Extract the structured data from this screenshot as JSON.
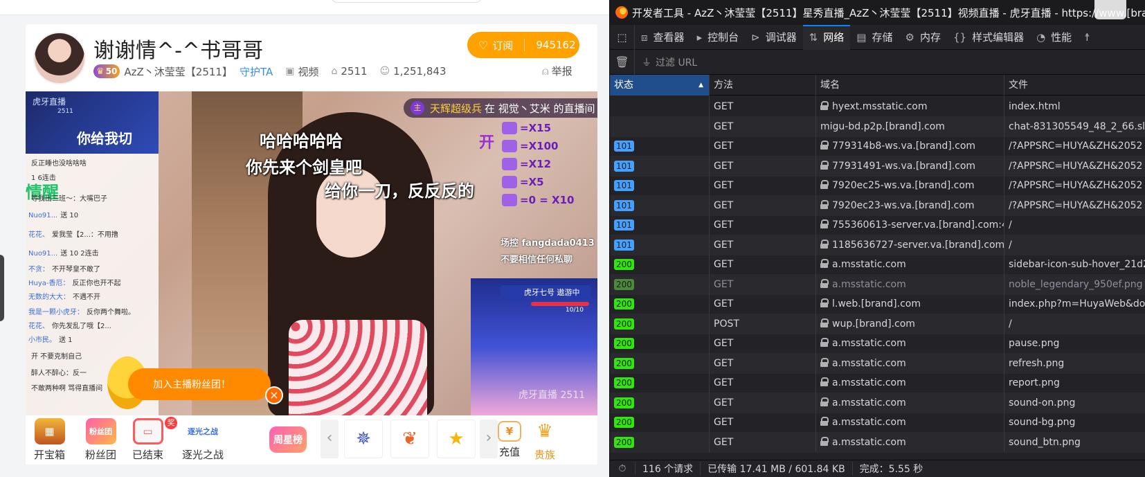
{
  "stream": {
    "title": "谢谢情^-^书哥哥",
    "level": "50",
    "anchor_name": "AzZ丶沐莹莹【2511】",
    "guard_link": "守护TA",
    "video_label": "视频",
    "room_id": "2511",
    "viewers": "1,251,843",
    "subscribe_label": "订阅",
    "subscribe_count": "945162",
    "report_label": "举报",
    "overlay": {
      "chat_banner_title": "虎牙直播",
      "chat_banner_id": "2511",
      "chat_banner_text": "你给我切",
      "wake_text": "情醒",
      "chat_lines": [
        {
          "user": "",
          "text": "反正睡也没啥啥啥"
        },
        {
          "user": "",
          "text": "1 6连击"
        },
        {
          "user": "",
          "text": "等我出三班～：大嘴巴子"
        },
        {
          "user": "Nuo91...",
          "text": "送 10"
        },
        {
          "user": "花花、",
          "text": "爱我莹【2...：不用撸"
        },
        {
          "user": "Nuo91...",
          "text": "送 10 2连击"
        },
        {
          "user": "不贪：",
          "text": "不开琴皇不敢了"
        },
        {
          "user": "Huya-香厄：",
          "text": "反正你也开不起"
        },
        {
          "user": "无数的大大：",
          "text": "不遇不开"
        },
        {
          "user": "我是一颗小虎牙：",
          "text": "反你两个舞啦。"
        },
        {
          "user": "花花、",
          "text": "你先发乱了哦【2..."
        },
        {
          "user": "小市民。",
          "text": "送 1"
        },
        {
          "user": "",
          "text": "开 不要克制自己"
        },
        {
          "user": "",
          "text": "醉人不醉心：反一"
        },
        {
          "user": "",
          "text": "不敢两种啊 骂得直播间"
        }
      ],
      "caption_1": "哈哈哈哈哈",
      "caption_2": "你先来个剑皇吧",
      "caption_3": "给你一刀，反反反的",
      "ticker_tag": "主",
      "ticker_highlight": "天辉超级兵",
      "ticker_text": "在 视觉丶艾米 的直播间",
      "kai": "开",
      "gift_rows": [
        "=X15",
        "=X100",
        "=X12",
        "=X5",
        "=0 = X10"
      ],
      "contact": "场控 fangdada0413",
      "warning": "不要相信任何私聊",
      "game_title": "虎牙七号 遨游中",
      "game_count": "10/10",
      "watermark": "虎牙直播 2511",
      "fan_bubble": "加入主播粉丝团！"
    },
    "toolbar": {
      "treasure": "开宝箱",
      "fan_club": "粉丝团",
      "fan_club_icon_text": "粉丝团",
      "ended": "已结束",
      "ended_badge": "奖",
      "chase_light": "逐光之战",
      "chase_light_icon_text": "逐光之战",
      "weekstar": "周星榜",
      "recharge": "充值",
      "noble": "贵族"
    }
  },
  "devtools": {
    "window_title": "开发者工具 - AzZ丶沐莹莹【2511】星秀直播_AzZ丶沐莹莹【2511】视频直播 - 虎牙直播 - https://www.[brand].",
    "tabs": [
      {
        "label": "查看器",
        "icon": "inspector-icon"
      },
      {
        "label": "控制台",
        "icon": "console-icon"
      },
      {
        "label": "调试器",
        "icon": "debugger-icon"
      },
      {
        "label": "网络",
        "icon": "network-icon"
      },
      {
        "label": "存储",
        "icon": "storage-icon"
      },
      {
        "label": "内存",
        "icon": "memory-icon"
      },
      {
        "label": "样式编辑器",
        "icon": "style-editor-icon"
      },
      {
        "label": "性能",
        "icon": "performance-icon"
      }
    ],
    "active_tab": "网络",
    "filter_placeholder": "过滤 URL",
    "columns": {
      "status": "状态",
      "method": "方法",
      "domain": "域名",
      "file": "文件"
    },
    "requests": [
      {
        "status": "",
        "method": "GET",
        "domain": "hyext.msstatic.com",
        "file": "index.html",
        "secure": true,
        "cached": false
      },
      {
        "status": "",
        "method": "GET",
        "domain": "migu-bd.p2p.[brand].com",
        "file": "chat-831305549_48_2_66.slice",
        "secure": false,
        "cached": false
      },
      {
        "status": "101",
        "method": "GET",
        "domain": "779314b8-ws.va.[brand].com",
        "file": "/?APPSRC=HUYA&ZH&2052",
        "secure": true,
        "cached": false
      },
      {
        "status": "101",
        "method": "GET",
        "domain": "77931491-ws.va.[brand].com",
        "file": "/?APPSRC=HUYA&ZH&2052",
        "secure": true,
        "cached": false
      },
      {
        "status": "101",
        "method": "GET",
        "domain": "7920ec25-ws.va.[brand].com",
        "file": "/?APPSRC=HUYA&ZH&2052",
        "secure": true,
        "cached": false
      },
      {
        "status": "101",
        "method": "GET",
        "domain": "7920ec23-ws.va.[brand].com",
        "file": "/?APPSRC=HUYA&ZH&2052",
        "secure": true,
        "cached": false
      },
      {
        "status": "101",
        "method": "GET",
        "domain": "755360613-server.va.[brand].com:4457",
        "file": "/",
        "secure": true,
        "cached": false
      },
      {
        "status": "101",
        "method": "GET",
        "domain": "1185636727-server.va.[brand].com:44...",
        "file": "/",
        "secure": true,
        "cached": false
      },
      {
        "status": "200",
        "method": "GET",
        "domain": "a.msstatic.com",
        "file": "sidebar-icon-sub-hover_21d2",
        "secure": true,
        "cached": false
      },
      {
        "status": "200",
        "method": "GET",
        "domain": "a.msstatic.com",
        "file": "noble_legendary_950ef.png",
        "secure": true,
        "cached": true
      },
      {
        "status": "200",
        "method": "GET",
        "domain": "l.web.[brand].com",
        "file": "index.php?m=HuyaWeb&do=",
        "secure": true,
        "cached": false
      },
      {
        "status": "200",
        "method": "POST",
        "domain": "wup.[brand].com",
        "file": "/",
        "secure": true,
        "cached": false
      },
      {
        "status": "200",
        "method": "GET",
        "domain": "a.msstatic.com",
        "file": "pause.png",
        "secure": true,
        "cached": false
      },
      {
        "status": "200",
        "method": "GET",
        "domain": "a.msstatic.com",
        "file": "refresh.png",
        "secure": true,
        "cached": false
      },
      {
        "status": "200",
        "method": "GET",
        "domain": "a.msstatic.com",
        "file": "report.png",
        "secure": true,
        "cached": false
      },
      {
        "status": "200",
        "method": "GET",
        "domain": "a.msstatic.com",
        "file": "sound-on.png",
        "secure": true,
        "cached": false
      },
      {
        "status": "200",
        "method": "GET",
        "domain": "a.msstatic.com",
        "file": "sound-bg.png",
        "secure": true,
        "cached": false
      },
      {
        "status": "200",
        "method": "GET",
        "domain": "a.msstatic.com",
        "file": "sound_btn.png",
        "secure": true,
        "cached": false
      }
    ],
    "status_bar": {
      "requests": "116 个请求",
      "transferred": "已传输 17.41 MB / 601.84 KB",
      "finished": "完成：5.55 秒"
    }
  }
}
